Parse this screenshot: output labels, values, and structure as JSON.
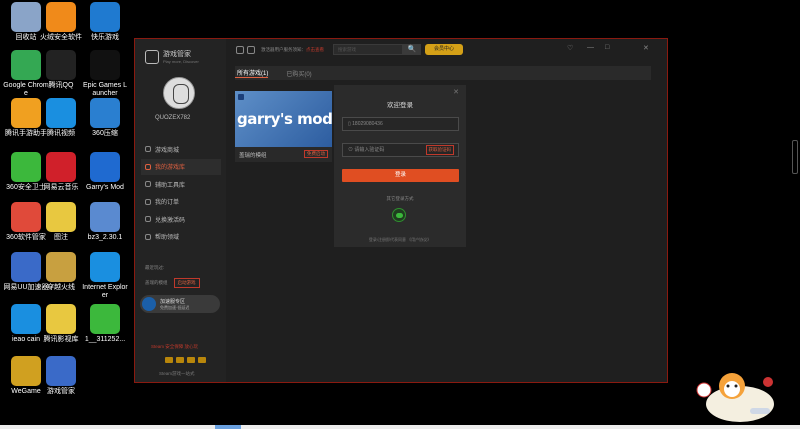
{
  "desktop": {
    "icons": [
      {
        "label": "回收站",
        "icon": "recycle-bin-icon",
        "color": "#8aa4c8"
      },
      {
        "label": "火绒安全软件",
        "icon": "huorong-icon",
        "color": "#f08a1a"
      },
      {
        "label": "快乐游戏",
        "icon": "game-icon",
        "color": "#1f7ad0"
      },
      {
        "label": "Google Chrome",
        "icon": "chrome-icon",
        "color": "#34a853"
      },
      {
        "label": "腾讯QQ",
        "icon": "qq-icon",
        "color": "#222222"
      },
      {
        "label": "Epic Games Launcher",
        "icon": "epic-icon",
        "color": "#111111"
      },
      {
        "label": "腾讯手游助手",
        "icon": "tencent-mobile-icon",
        "color": "#f0a020"
      },
      {
        "label": "腾讯视频",
        "icon": "tencent-video-icon",
        "color": "#1a8fe0"
      },
      {
        "label": "360压缩",
        "icon": "zip-icon",
        "color": "#2a7fd0"
      },
      {
        "label": "360安全卫士",
        "icon": "360-safe-icon",
        "color": "#3cb83c"
      },
      {
        "label": "网易云音乐",
        "icon": "netease-music-icon",
        "color": "#d0202a"
      },
      {
        "label": "Garry's Mod",
        "icon": "garrys-mod-icon",
        "color": "#1f6ad0"
      },
      {
        "label": "360软件管家",
        "icon": "360-software-icon",
        "color": "#e04a3a"
      },
      {
        "label": "图注",
        "icon": "image-icon",
        "color": "#e8c840"
      },
      {
        "label": "bz3_2.30.1",
        "icon": "app-icon",
        "color": "#5a8ad0"
      },
      {
        "label": "网易UU加速器",
        "icon": "uu-icon",
        "color": "#3a6ac8"
      },
      {
        "label": "穿越火线",
        "icon": "crossfire-icon",
        "color": "#c8a040"
      },
      {
        "label": "Internet Explorer",
        "icon": "ie-icon",
        "color": "#1a8fe0"
      },
      {
        "label": "ieao cain",
        "icon": "ie-icon",
        "color": "#1a8fe0"
      },
      {
        "label": "腾讯影视库",
        "icon": "folder-icon",
        "color": "#e8c840"
      },
      {
        "label": "1__311252...",
        "icon": "app-icon",
        "color": "#3cb83c"
      },
      {
        "label": "WeGame",
        "icon": "wegame-icon",
        "color": "#d0a020"
      },
      {
        "label": "游戏管家",
        "icon": "game-manager-icon",
        "color": "#3a6ac8"
      }
    ]
  },
  "window": {
    "brand": {
      "title": "游戏管家",
      "subtitle": "Play more, Discover"
    },
    "user": {
      "name": "QUOZEX782"
    },
    "menu": [
      {
        "label": "游戏商城"
      },
      {
        "label": "我的游戏库"
      },
      {
        "label": "辅助工具库"
      },
      {
        "label": "我的订单"
      },
      {
        "label": "兑换激活码"
      },
      {
        "label": "帮助领域"
      }
    ],
    "recent": {
      "title": "最近玩过:",
      "game": "盖瑞的模组",
      "action": "启动游戏"
    },
    "accelerator": {
      "title": "加速服专区",
      "subtitle": "免费加速·低延迟"
    },
    "secure_text": "Steam 安全保障 放心玩",
    "bottom_text": "Steam游戏一站式",
    "topbar": {
      "notice": "激活器用户服务须知：",
      "notice_link": "点击查看",
      "search_placeholder": "搜索游戏",
      "search_btn": "🔍",
      "vip_label": "会员中心",
      "min_icon": "—",
      "max_icon": "□",
      "close_icon": "✕"
    },
    "tabs": [
      {
        "label": "所有游戏(1)"
      },
      {
        "label": "已购买(0)"
      }
    ],
    "game_card": {
      "art_text": "garry's mod",
      "name": "盖瑞的模组",
      "action": "免费启动"
    }
  },
  "login_dialog": {
    "title": "欢迎登录",
    "phone": "18029080436",
    "code_placeholder": "请输入验证码",
    "code_button": "获取验证码",
    "login_button": "登录",
    "other_methods": "其它登录方式",
    "agreement": "登录/注册即代表同意 《用户协议》",
    "close_icon": "✕"
  },
  "colors": {
    "accent": "#e04e22",
    "border": "#8a1a10",
    "vip": "#d4a017"
  }
}
